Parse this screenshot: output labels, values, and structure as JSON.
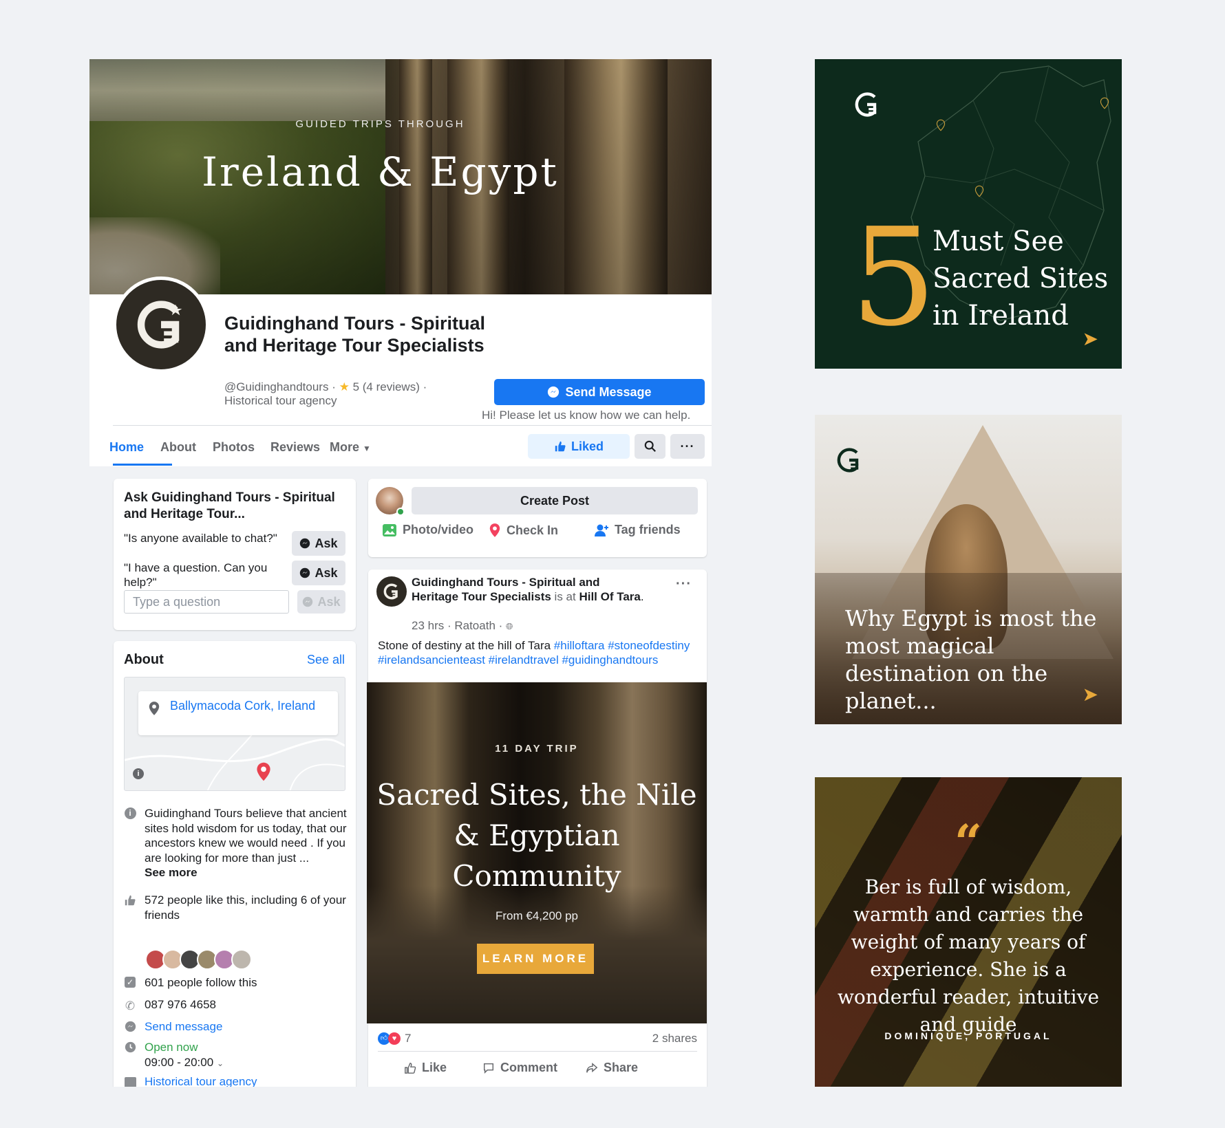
{
  "cover": {
    "kicker": "GUIDED TRIPS THROUGH",
    "title": "Ireland & Egypt"
  },
  "page": {
    "name": "Guidinghand Tours - Spiritual and Heritage Tour Specialists",
    "handle": "@Guidinghandtours · ",
    "rating": "5 (4 reviews) · ",
    "category": "Historical tour agency",
    "send_message_label": "Send Message",
    "send_hint": "Hi! Please let us know how we can help."
  },
  "tabs": [
    {
      "label": "Home"
    },
    {
      "label": "About"
    },
    {
      "label": "Photos"
    },
    {
      "label": "Reviews"
    },
    {
      "label": "More"
    }
  ],
  "actions": {
    "liked_label": "Liked"
  },
  "ask": {
    "title": "Ask Guidinghand Tours - Spiritual and Heritage Tour...",
    "questions": [
      {
        "text": "\"Is anyone available to chat?\"",
        "button": "Ask"
      },
      {
        "text": "\"I have a question. Can you help?\"",
        "button": "Ask"
      }
    ],
    "input_placeholder": "Type a question",
    "input_button": "Ask"
  },
  "about": {
    "title": "About",
    "see_all": "See all",
    "address": "Ballymacoda Cork, Ireland",
    "description": "Guidinghand Tours believe that ancient sites hold wisdom for us today, that our ancestors knew we would need . If you are looking for more than just ...",
    "see_more": "See more",
    "likes": "572 people like this, including 6 of your friends",
    "follows": "601 people follow this",
    "phone": "087 976 4658",
    "send_message": "Send message",
    "open_now": "Open now",
    "hours": "09:00 - 20:00",
    "category_link": "Historical tour agency"
  },
  "composer": {
    "create_post": "Create Post",
    "photo_video": "Photo/video",
    "check_in": "Check In",
    "tag_friends": "Tag friends"
  },
  "post": {
    "author": "Guidinghand Tours - Spiritual and Heritage Tour Specialists",
    "is_at": " is at ",
    "place": "Hill Of Tara",
    "period": ".",
    "time": "23 hrs · Ratoath · ",
    "text": "Stone of destiny at the hill of Tara ",
    "hashtags": "#hilloftara #stoneofdestiny #irelandsancienteast #irelandtravel #guidinghandtours",
    "image_kicker": "11 DAY TRIP",
    "image_title": "Sacred Sites, the Nile & Egyptian Community",
    "image_price": "From €4,200 pp",
    "image_button": "LEARN MORE",
    "reaction_count": "7",
    "shares": "2 shares",
    "like": "Like",
    "comment": "Comment",
    "share": "Share"
  },
  "tiles": {
    "t1_number": "5",
    "t1_text": "Must See Sacred Sites in Ireland",
    "t2_text": "Why Egypt is most the most magical destination on the planet...",
    "t3_quote_mark": "“",
    "t3_text": "Ber is full of wisdom, warmth and carries the weight of many years of experience. She is a wonderful reader, intuitive and guide",
    "t3_author": "DOMINIQUE, PORTUGAL"
  },
  "colors": {
    "fb_blue": "#1877f2",
    "accent_gold": "#e8a83a",
    "tile_green": "#0d2a1c",
    "online_green": "#31a24c"
  },
  "icons": [
    "messenger-icon",
    "star-icon",
    "thumbs-up-icon",
    "search-icon",
    "more-dots-icon",
    "location-pin-icon",
    "info-icon",
    "like-icon",
    "follow-check-icon",
    "phone-icon",
    "clock-icon",
    "category-icon",
    "photo-icon",
    "tag-friends-icon",
    "globe-icon",
    "love-reaction-icon",
    "comment-icon",
    "share-icon",
    "arrow-right-icon",
    "guidinghand-logo-icon"
  ]
}
